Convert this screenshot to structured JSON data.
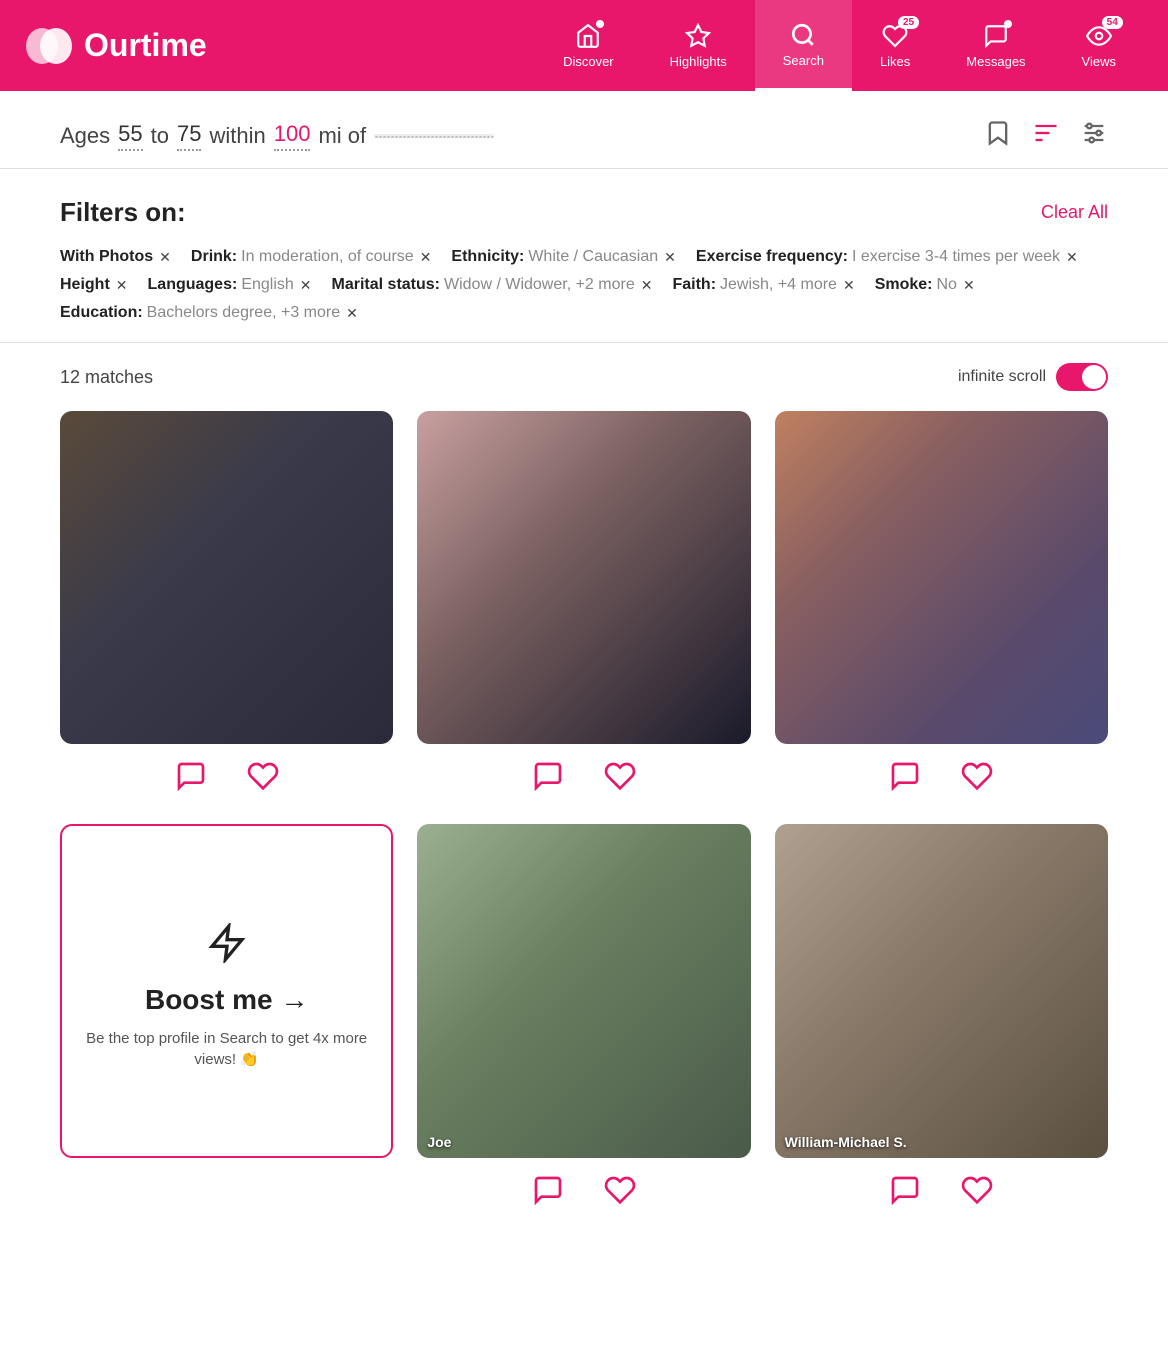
{
  "nav": {
    "logo_text": "Ourtime",
    "items": [
      {
        "id": "discover",
        "label": "Discover",
        "badge": null,
        "dot": true,
        "active": false
      },
      {
        "id": "highlights",
        "label": "Highlights",
        "badge": null,
        "dot": false,
        "active": false
      },
      {
        "id": "search",
        "label": "Search",
        "badge": null,
        "dot": false,
        "active": true
      },
      {
        "id": "likes",
        "label": "Likes",
        "badge": "25",
        "dot": false,
        "active": false
      },
      {
        "id": "messages",
        "label": "Messages",
        "badge": null,
        "dot": true,
        "active": false
      },
      {
        "id": "views",
        "label": "Views",
        "badge": "54",
        "dot": false,
        "active": false
      }
    ]
  },
  "search_bar": {
    "ages_label": "Ages",
    "age_min": "55",
    "age_to": "to",
    "age_max": "75",
    "within_label": "within",
    "within_val": "100",
    "mi_of": "mi of",
    "location": ""
  },
  "filters": {
    "title": "Filters on:",
    "clear_all": "Clear All",
    "tags": [
      {
        "key": "With Photos",
        "val": "",
        "has_val": false
      },
      {
        "key": "Drink:",
        "val": "In moderation, of course",
        "has_val": true
      },
      {
        "key": "Ethnicity:",
        "val": "White / Caucasian",
        "has_val": true
      },
      {
        "key": "Exercise frequency:",
        "val": "I exercise 3-4 times per week",
        "has_val": true
      },
      {
        "key": "Height",
        "val": "",
        "has_val": false
      },
      {
        "key": "Languages:",
        "val": "English",
        "has_val": true
      },
      {
        "key": "Marital status:",
        "val": "Widow / Widower, +2 more",
        "has_val": true
      },
      {
        "key": "Faith:",
        "val": "Jewish, +4 more",
        "has_val": true
      },
      {
        "key": "Smoke:",
        "val": "No",
        "has_val": true
      },
      {
        "key": "Education:",
        "val": "Bachelors degree, +3 more",
        "has_val": true
      }
    ]
  },
  "results": {
    "count": "12 matches",
    "infinite_scroll_label": "infinite scroll",
    "cards": [
      {
        "id": 1,
        "blur_class": "blur-overlay-1",
        "name": null
      },
      {
        "id": 2,
        "blur_class": "blur-overlay-2",
        "name": null
      },
      {
        "id": 3,
        "blur_class": "blur-overlay-3",
        "name": null
      },
      {
        "id": 4,
        "boost": true
      },
      {
        "id": 5,
        "blur_class": "blur-overlay-4",
        "name": "Joe"
      },
      {
        "id": 6,
        "blur_class": "blur-overlay-5",
        "name": "William-Michael S."
      }
    ],
    "boost_card": {
      "icon": "⚡",
      "title": "Boost me →",
      "desc": "Be the top profile in Search to get 4x more views! 👏"
    }
  }
}
